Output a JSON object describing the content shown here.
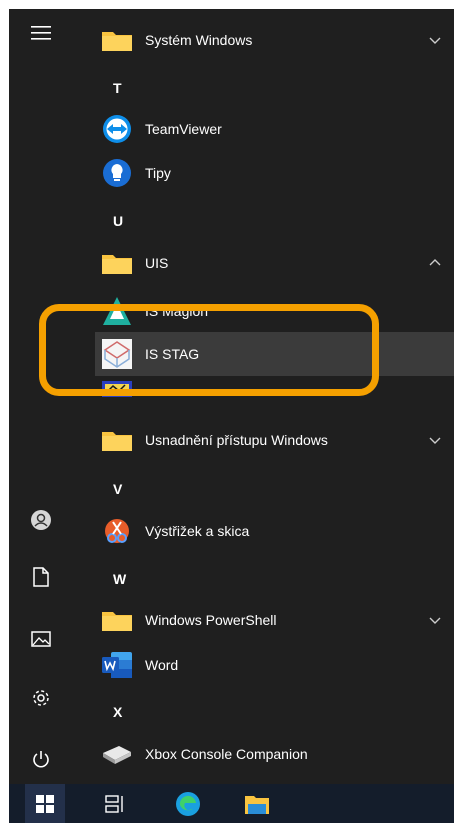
{
  "apps": {
    "systemWindows": "Systém Windows",
    "letterT": "T",
    "teamviewer": "TeamViewer",
    "tipy": "Tipy",
    "letterU": "U",
    "uis": "UIS",
    "isMagion": "IS Magion",
    "isStag": "IS STAG",
    "letterUnknown": "",
    "usnadneni": "Usnadnění přístupu Windows",
    "letterV": "V",
    "vystrizek": "Výstřižek a skica",
    "letterW": "W",
    "powershell": "Windows PowerShell",
    "word": "Word",
    "letterX": "X",
    "xbox": "Xbox Console Companion"
  },
  "colors": {
    "menuBg": "#1f1f1f",
    "selectedBg": "#3b3b3b",
    "highlight": "#f5a000",
    "taskbar": "#141d2b"
  },
  "icons": {
    "hamburger": "hamburger-menu-icon",
    "user": "user-avatar-icon",
    "documents": "document-icon",
    "pictures": "pictures-icon",
    "settings": "gear-icon",
    "power": "power-icon"
  }
}
